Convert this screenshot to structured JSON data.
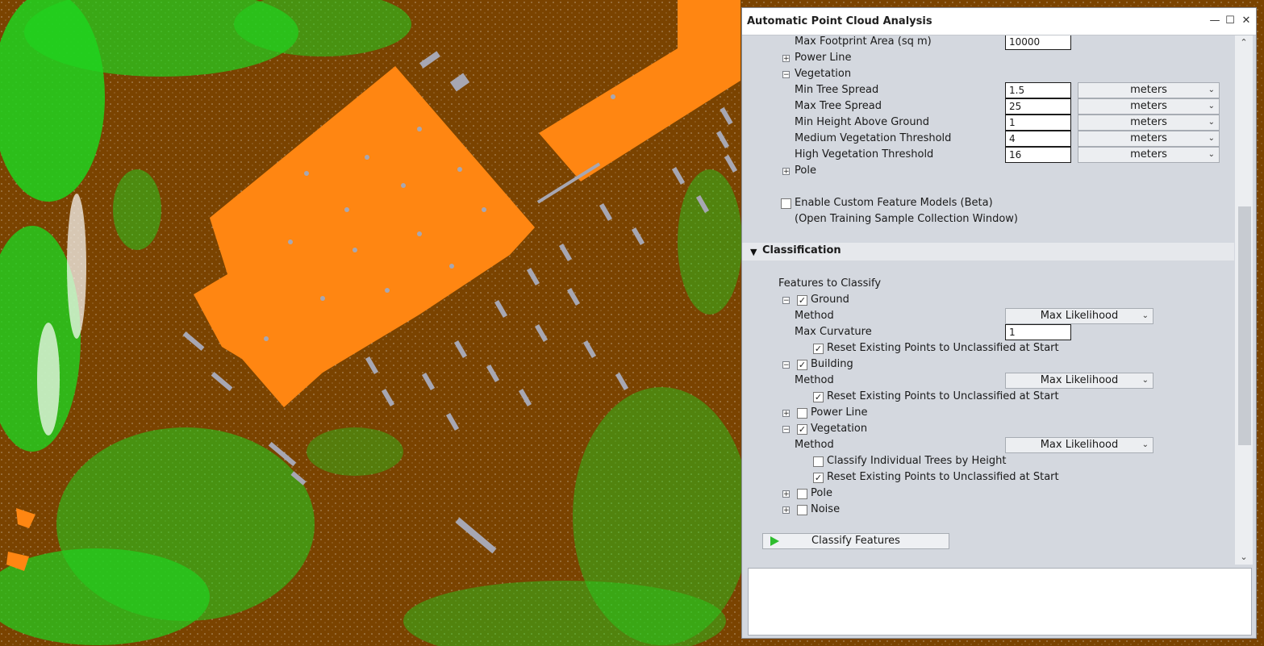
{
  "colors": {
    "ground": "#7a4300",
    "building": "#ff8612",
    "vegetation": "#1fd31f",
    "unclassified": "#a7a7b3",
    "panel_bg": "#d4d8df"
  },
  "panel": {
    "title": "Automatic Point Cloud Analysis",
    "building_settings": {
      "max_footprint_label": "Max Footprint Area (sq m)",
      "max_footprint_value": "10000"
    },
    "power_line_label": "Power Line",
    "vegetation": {
      "label": "Vegetation",
      "rows": [
        {
          "label": "Min Tree Spread",
          "value": "1.5",
          "unit": "meters"
        },
        {
          "label": "Max Tree Spread",
          "value": "25",
          "unit": "meters"
        },
        {
          "label": "Min Height Above Ground",
          "value": "1",
          "unit": "meters"
        },
        {
          "label": "Medium Vegetation Threshold",
          "value": "4",
          "unit": "meters"
        },
        {
          "label": "High Vegetation Threshold",
          "value": "16",
          "unit": "meters"
        }
      ]
    },
    "pole_label": "Pole",
    "custom_models_label": "Enable Custom Feature Models (Beta)",
    "training_link": "(Open Training Sample Collection Window)",
    "classification": {
      "header": "Classification",
      "features_label": "Features to Classify",
      "ground": {
        "label": "Ground",
        "method_label": "Method",
        "method_value": "Max Likelihood",
        "curvature_label": "Max Curvature",
        "curvature_value": "1",
        "reset_label": "Reset Existing Points to Unclassified at Start"
      },
      "building": {
        "label": "Building",
        "method_label": "Method",
        "method_value": "Max Likelihood",
        "reset_label": "Reset Existing Points to Unclassified at Start"
      },
      "power_line": {
        "label": "Power Line"
      },
      "vegetation": {
        "label": "Vegetation",
        "method_label": "Method",
        "method_value": "Max Likelihood",
        "trees_label": "Classify Individual Trees by Height",
        "reset_label": "Reset Existing Points to Unclassified at Start"
      },
      "pole": {
        "label": "Pole"
      },
      "noise": {
        "label": "Noise"
      },
      "button_label": "Classify Features"
    }
  }
}
